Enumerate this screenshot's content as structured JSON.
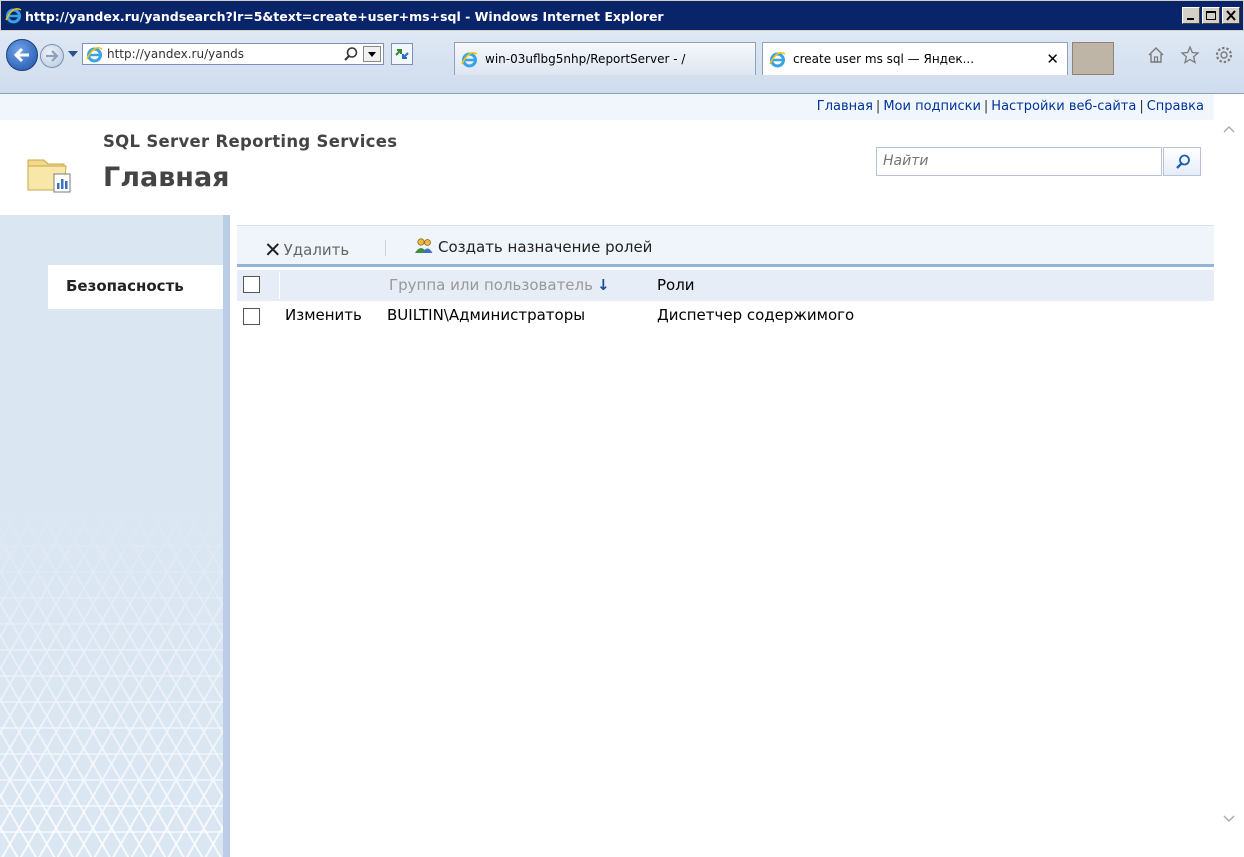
{
  "window": {
    "title": "http://yandex.ru/yandsearch?lr=5&text=create+user+ms+sql - Windows Internet Explorer"
  },
  "browser": {
    "address": "http://yandex.ru/yands",
    "tabs": [
      {
        "label": "win-03uflbg5nhp/ReportServer - /"
      },
      {
        "label": "create user ms sql — Яндек..."
      }
    ],
    "close_glyph": "✕"
  },
  "toplinks": {
    "home": "Главная",
    "subscriptions": "Мои подписки",
    "site_settings": "Настройки веб-сайта",
    "help": "Справка",
    "separator": "|"
  },
  "header": {
    "product": "SQL Server Reporting Services",
    "title": "Главная",
    "search_placeholder": "Найти"
  },
  "sidebar": {
    "items": [
      {
        "label": "Безопасность"
      }
    ]
  },
  "actions": {
    "delete_label": "Удалить",
    "delete_glyph": "✕",
    "new_role_label": "Создать назначение ролей"
  },
  "grid": {
    "columns": {
      "group_or_user": "Группа или пользователь",
      "sort_arrow": "↓",
      "roles": "Роли"
    },
    "rows": [
      {
        "edit": "Изменить",
        "user": "BUILTIN\\Администраторы",
        "role": "Диспетчер содержимого"
      }
    ]
  },
  "colors": {
    "titlebar": "#0a246a",
    "link": "#003399",
    "sidebar": "#dbe6f3",
    "grid_header": "#e6edf6"
  },
  "icons": [
    "ie-icon",
    "back-arrow-icon",
    "forward-arrow-icon",
    "search-icon",
    "refresh-icon",
    "home-icon",
    "star-icon",
    "gear-icon",
    "folder-report-icon",
    "users-icon",
    "minimize-icon",
    "maximize-icon",
    "close-icon",
    "scroll-up-icon",
    "scroll-down-icon"
  ]
}
